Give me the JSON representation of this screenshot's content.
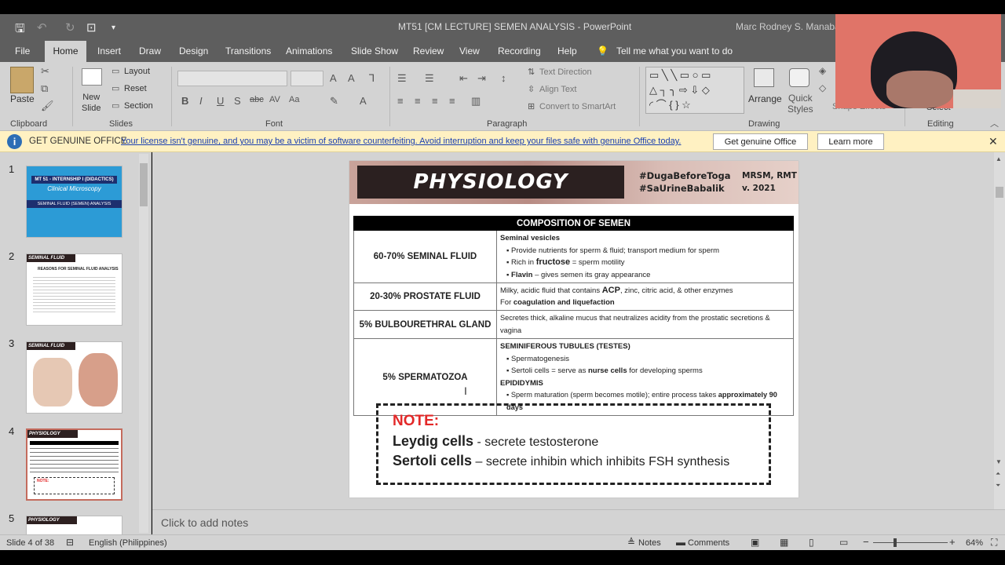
{
  "window": {
    "title": "MT51 [CM LECTURE] SEMEN ANALYSIS  -  PowerPoint",
    "user": "Marc Rodney S. Manaban"
  },
  "ribbon_tabs": [
    "File",
    "Home",
    "Insert",
    "Draw",
    "Design",
    "Transitions",
    "Animations",
    "Slide Show",
    "Review",
    "View",
    "Recording",
    "Help"
  ],
  "tell_me": "Tell me what you want to do",
  "ribbon": {
    "clipboard": {
      "paste": "Paste",
      "label": "Clipboard"
    },
    "slides": {
      "new_slide": "New\nSlide",
      "layout": "Layout",
      "reset": "Reset",
      "section": "Section",
      "label": "Slides"
    },
    "font": {
      "label": "Font"
    },
    "paragraph": {
      "text_direction": "Text Direction",
      "align_text": "Align Text",
      "smartart": "Convert to SmartArt",
      "label": "Paragraph"
    },
    "drawing": {
      "arrange": "Arrange",
      "quick_styles": "Quick\nStyles",
      "shape_effects": "Shape Effects",
      "label": "Drawing"
    },
    "editing": {
      "select": "Select",
      "label": "Editing"
    }
  },
  "banner": {
    "title": "GET GENUINE OFFICE",
    "message": "Your license isn't genuine, and you may be a victim of software counterfeiting. Avoid interruption and keep your files safe with genuine Office today.",
    "btn_genuine": "Get genuine Office",
    "btn_learn": "Learn more"
  },
  "thumbnails": {
    "nums": [
      "1",
      "2",
      "3",
      "4",
      "5"
    ],
    "t1_title": "MT 51 - INTERNSHIP I (DIDACTICS)",
    "t1_sub": "Clinical Microscopy",
    "t1_band": "SEMINAL FLUID (SEMEN) ANALYSIS",
    "t2_title": "SEMINAL FLUID",
    "t2_head": "REASONS FOR SEMINAL FLUID ANALYSIS",
    "t3_title": "SEMINAL FLUID",
    "t4_title": "PHYSIOLOGY",
    "t4_note": "NOTE:",
    "t5_title": "PHYSIOLOGY"
  },
  "slide": {
    "header_title": "PHYSIOLOGY",
    "hashtag1": "#DugaBeforeToga",
    "hashtag2": "#SaUrineBabalik",
    "meta1": "MRSM, RMT",
    "meta2": "v. 2021",
    "table_title": "COMPOSITION OF SEMEN",
    "rows": {
      "r1_left": "60-70% SEMINAL FLUID",
      "r1_head": "Seminal vesicles",
      "r1_b1": "Provide nutrients for sperm & fluid; transport medium for sperm",
      "r1_b2a": "Rich in ",
      "r1_b2b": "fructose",
      "r1_b2c": " = sperm motility",
      "r1_b3a": "Flavin",
      "r1_b3b": " – gives semen its gray appearance",
      "r2_left": "20-30% PROSTATE FLUID",
      "r2_l1a": "Milky, acidic fluid that contains ",
      "r2_l1b": "ACP",
      "r2_l1c": ", zinc, citric acid, & other enzymes",
      "r2_l2a": "For ",
      "r2_l2b": "coagulation and liquefaction",
      "r3_left": "5% BULBOURETHRAL GLAND",
      "r3_text": "Secretes thick, alkaline mucus that neutralizes acidity from the prostatic secretions & vagina",
      "r4_left": "5% SPERMATOZOA",
      "r4_h1": "SEMINIFEROUS TUBULES (TESTES)",
      "r4_b1": "Spermatogenesis",
      "r4_b2a": "Sertoli cells = serve as ",
      "r4_b2b": "nurse cells",
      "r4_b2c": " for developing sperms",
      "r4_h2": "EPIDIDYMIS",
      "r4_b3a": "Sperm maturation (sperm becomes motile); entire process takes ",
      "r4_b3b": "approximately 90 days"
    },
    "note_title": "NOTE:",
    "note1_bold": "Leydig cells",
    "note1_rest": " - secrete testosterone",
    "note2_bold": "Sertoli cells",
    "note2_rest": " – secrete inhibin which inhibits FSH synthesis"
  },
  "notes_placeholder": "Click to add notes",
  "status": {
    "slide_count": "Slide 4 of 38",
    "language": "English (Philippines)",
    "notes": "Notes",
    "comments": "Comments",
    "zoom": "64%"
  },
  "colors": {
    "title_bar": "#5e5e5e",
    "ribbon": "#d3d3d3",
    "banner": "#fff1c2",
    "accent_red": "#e32828"
  }
}
